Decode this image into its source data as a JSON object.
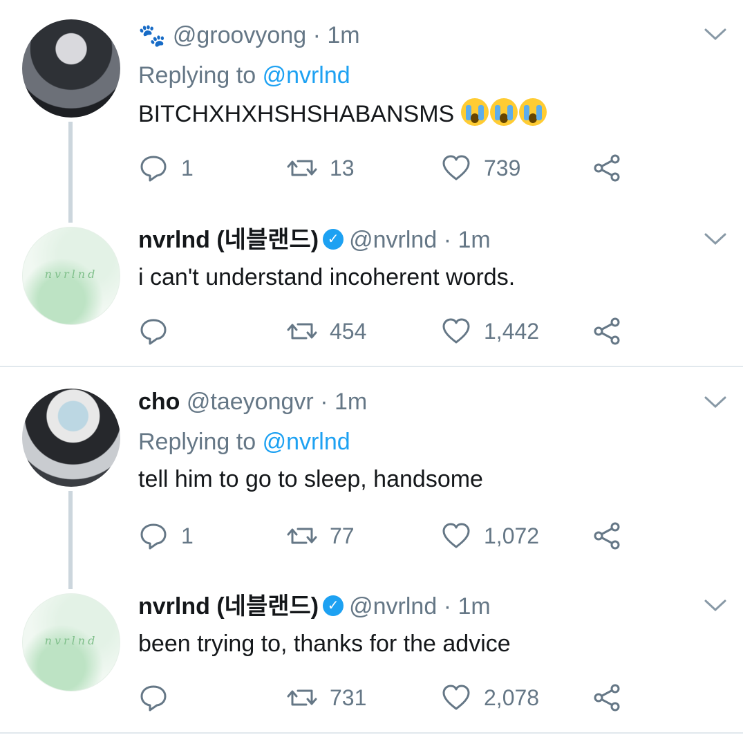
{
  "threads": [
    {
      "reply": {
        "name": "",
        "handle": "@groovyong",
        "sep": "·",
        "time": "1m",
        "replying_prefix": "Replying to",
        "replying_to": "@nvrlnd",
        "text": "BITCHXHXHSHSHABANSMS",
        "emoji": "loudly-crying-face x3",
        "replies": "1",
        "retweets": "13",
        "likes": "739"
      },
      "response": {
        "name": "nvrlnd (네블랜드)",
        "handle": "@nvrlnd",
        "sep": "·",
        "time": "1m",
        "text": "i can't understand incoherent words.",
        "replies": "",
        "retweets": "454",
        "likes": "1,442",
        "avatar_text": "nvrlnd"
      }
    },
    {
      "reply": {
        "name": "cho",
        "handle": "@taeyongvr",
        "sep": "·",
        "time": "1m",
        "replying_prefix": "Replying to",
        "replying_to": "@nvrlnd",
        "text": "tell him to go to sleep, handsome",
        "replies": "1",
        "retweets": "77",
        "likes": "1,072"
      },
      "response": {
        "name": "nvrlnd (네블랜드)",
        "handle": "@nvrlnd",
        "sep": "·",
        "time": "1m",
        "text": "been trying to, thanks for the advice",
        "replies": "",
        "retweets": "731",
        "likes": "2,078",
        "avatar_text": "nvrlnd"
      }
    }
  ],
  "icons": {
    "reply": "reply-icon",
    "retweet": "retweet-icon",
    "like": "heart-icon",
    "share": "share-icon",
    "more": "chevron-down-icon",
    "verified": "verified-badge-icon",
    "paw": "paw-prints-icon"
  },
  "colors": {
    "accent": "#1da1f2",
    "secondary_text": "#657786",
    "thread_line": "#ccd6dd",
    "divider": "#e1e8ed"
  }
}
